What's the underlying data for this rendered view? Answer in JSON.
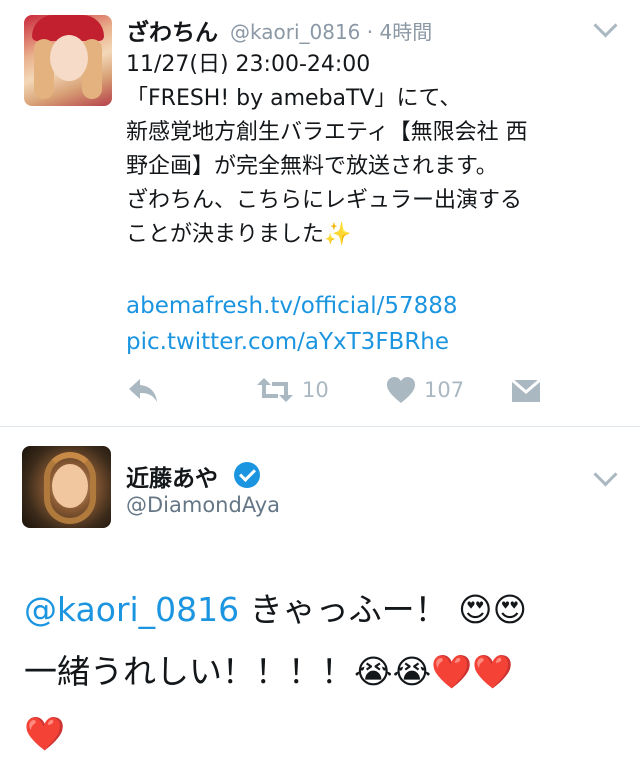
{
  "tweet1": {
    "name": "ざわちん",
    "handle_time": "@kaori_0816 · 4時間",
    "lines": [
      "11/27(日) 23:00-24:00",
      "「FRESH! by amebaTV」にて、",
      "新感覚地方創生バラエティ【無限会社 西",
      "野企画】が完全無料で放送されます。",
      "ざわちん、こちらにレギュラー出演する",
      "ことが決まりました✨"
    ],
    "links": [
      "abemafresh.tv/official/57888",
      "pic.twitter.com/aYxT3FBRhe"
    ],
    "actions": {
      "retweet_count": "10",
      "like_count": "107"
    },
    "icons": {
      "reply": "reply-icon",
      "retweet": "retweet-icon",
      "like": "heart-icon",
      "dm": "direct-message-icon",
      "menu": "chevron-down-icon"
    }
  },
  "tweet2": {
    "name": "近藤あや",
    "handle": "@DiamondAya",
    "mention": "@kaori_0816",
    "line1_text": " きゃっふー！",
    "line2_text": "一緒うれしい！！！！",
    "emojis": {
      "heart_eyes": "😍",
      "crying": "😭",
      "heart": "❤️"
    }
  },
  "colors": {
    "link": "#1b95e0",
    "meta": "#8b98a5",
    "icon": "#aab8c2",
    "divider": "#e1e8ed"
  }
}
